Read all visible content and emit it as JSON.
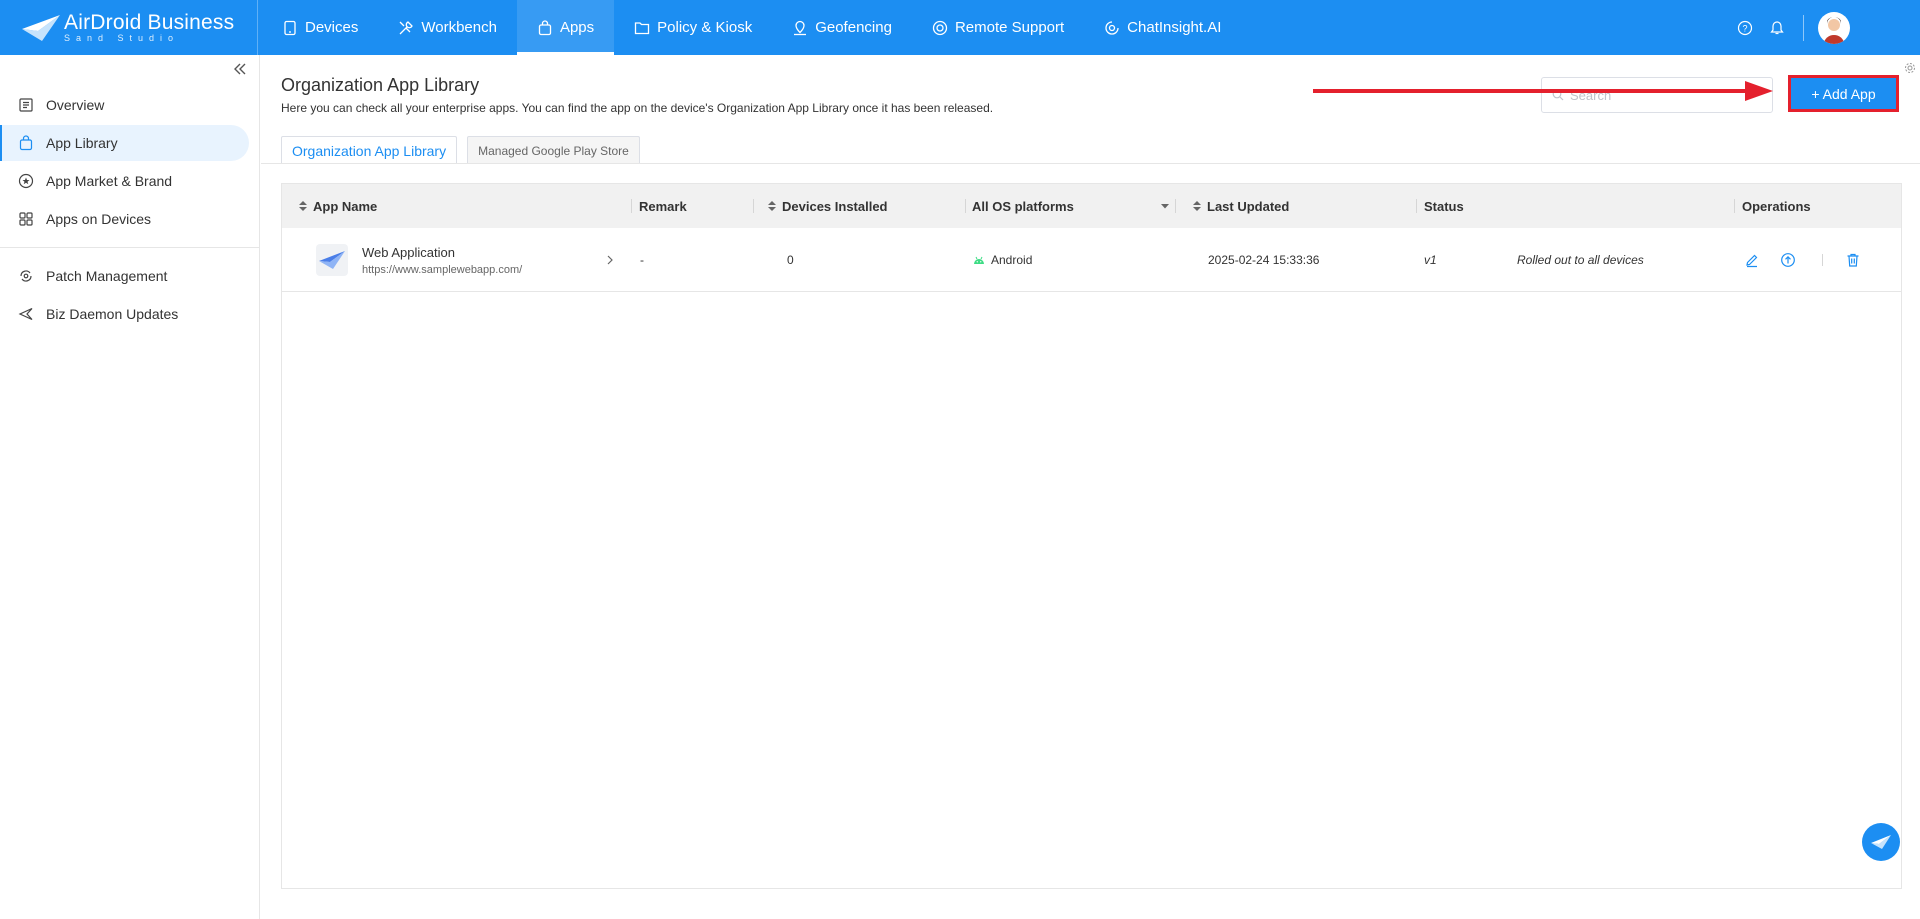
{
  "brand": {
    "name": "AirDroid Business",
    "tagline": "Sand Studio"
  },
  "nav": [
    {
      "label": "Devices",
      "icon": "tablet-icon"
    },
    {
      "label": "Workbench",
      "icon": "tools-icon"
    },
    {
      "label": "Apps",
      "icon": "bag-icon",
      "active": true
    },
    {
      "label": "Policy & Kiosk",
      "icon": "folder-icon"
    },
    {
      "label": "Geofencing",
      "icon": "location-icon"
    },
    {
      "label": "Remote Support",
      "icon": "lifebuoy-icon"
    },
    {
      "label": "ChatInsight.AI",
      "icon": "ai-icon"
    }
  ],
  "sidebar": {
    "items": [
      {
        "label": "Overview",
        "icon": "list-icon"
      },
      {
        "label": "App Library",
        "icon": "bag-icon",
        "active": true
      },
      {
        "label": "App Market & Brand",
        "icon": "star-circle-icon"
      },
      {
        "label": "Apps on Devices",
        "icon": "grid-icon"
      },
      {
        "label": "Patch Management",
        "icon": "patch-icon"
      },
      {
        "label": "Biz Daemon Updates",
        "icon": "send-icon"
      }
    ]
  },
  "page": {
    "title": "Organization App Library",
    "description": "Here you can check all your enterprise apps. You can find the app on the device's Organization App Library once it has been released.",
    "search_placeholder": "Search",
    "add_button": "+ Add App"
  },
  "tabs": [
    {
      "label": "Organization App Library",
      "active": true
    },
    {
      "label": "Managed Google Play Store"
    }
  ],
  "table": {
    "headers": {
      "app_name": "App Name",
      "remark": "Remark",
      "devices_installed": "Devices Installed",
      "os": "All OS platforms",
      "last_updated": "Last Updated",
      "status": "Status",
      "operations": "Operations"
    },
    "rows": [
      {
        "name": "Web Application",
        "url": "https://www.samplewebapp.com/",
        "remark": "-",
        "devices_installed": "0",
        "os": "Android",
        "last_updated": "2025-02-24 15:33:36",
        "version": "v1",
        "status": "Rolled out to all devices"
      }
    ]
  },
  "colors": {
    "primary": "#1c8ef2",
    "highlight": "#e4202d",
    "android": "#3ddc84"
  }
}
